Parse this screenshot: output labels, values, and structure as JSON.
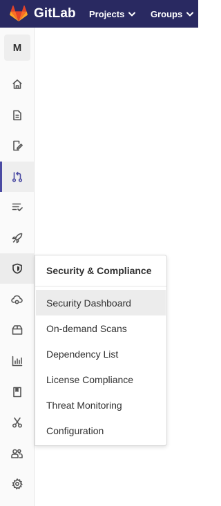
{
  "navbar": {
    "brand": "GitLab",
    "projects_label": "Projects",
    "groups_label": "Groups",
    "background": "#292961"
  },
  "sidebar": {
    "avatar_letter": "M",
    "items": [
      {
        "icon": "home-icon"
      },
      {
        "icon": "file-icon"
      },
      {
        "icon": "issues-icon"
      },
      {
        "icon": "merge-request-icon",
        "active": true
      },
      {
        "icon": "requirements-icon"
      },
      {
        "icon": "rocket-icon"
      },
      {
        "icon": "shield-icon",
        "hovered": true
      },
      {
        "icon": "cloud-icon"
      },
      {
        "icon": "package-icon"
      },
      {
        "icon": "analytics-icon"
      },
      {
        "icon": "book-icon"
      },
      {
        "icon": "snippet-icon"
      },
      {
        "icon": "members-icon"
      },
      {
        "icon": "gear-icon"
      }
    ],
    "active_color": "#4b4ba3"
  },
  "flyout": {
    "title": "Security & Compliance",
    "items": [
      "Security Dashboard",
      "On-demand Scans",
      "Dependency List",
      "License Compliance",
      "Threat Monitoring",
      "Configuration"
    ],
    "highlighted_index": 0
  }
}
